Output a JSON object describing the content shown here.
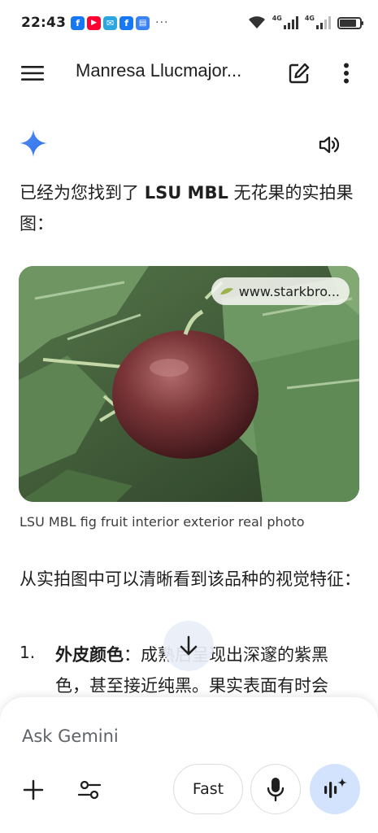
{
  "status_bar": {
    "time": "22:43",
    "notifications": [
      {
        "name": "facebook-icon",
        "glyph": "f",
        "color": "#1877f2"
      },
      {
        "name": "youtube-icon",
        "glyph": "▶",
        "color": "#ff0033"
      },
      {
        "name": "mail-icon",
        "glyph": "✉",
        "color": "#2aa7e0"
      },
      {
        "name": "facebook-icon",
        "glyph": "f",
        "color": "#1877f2"
      },
      {
        "name": "clipboard-icon",
        "glyph": "▤",
        "color": "#3b82f6"
      }
    ],
    "more": "···",
    "network_1": "4G",
    "network_2": "4G",
    "battery_level": 0.85
  },
  "app_bar": {
    "title": "Manresa Llucmajor..."
  },
  "response": {
    "intro_text": "已经为您找到了",
    "intro_bold": "LSU MBL",
    "intro_rest": "无花果的实拍果图：",
    "image_source": "www.starkbro...",
    "image_caption": "LSU MBL fig fruit interior exterior real photo",
    "para2": "从实拍图中可以清晰看到该品种的视觉特征：",
    "list_number": "1.",
    "list_bold": "外皮颜色",
    "list_text": "：成熟后呈现出深邃的紫黑色，甚至接近纯黑。果实表面有时会"
  },
  "input": {
    "placeholder": "Ask Gemini",
    "fast_label": "Fast"
  },
  "colors": {
    "accent": "#4285f4",
    "live_button_bg": "#d3e3fd",
    "text": "#1f1f1f"
  }
}
